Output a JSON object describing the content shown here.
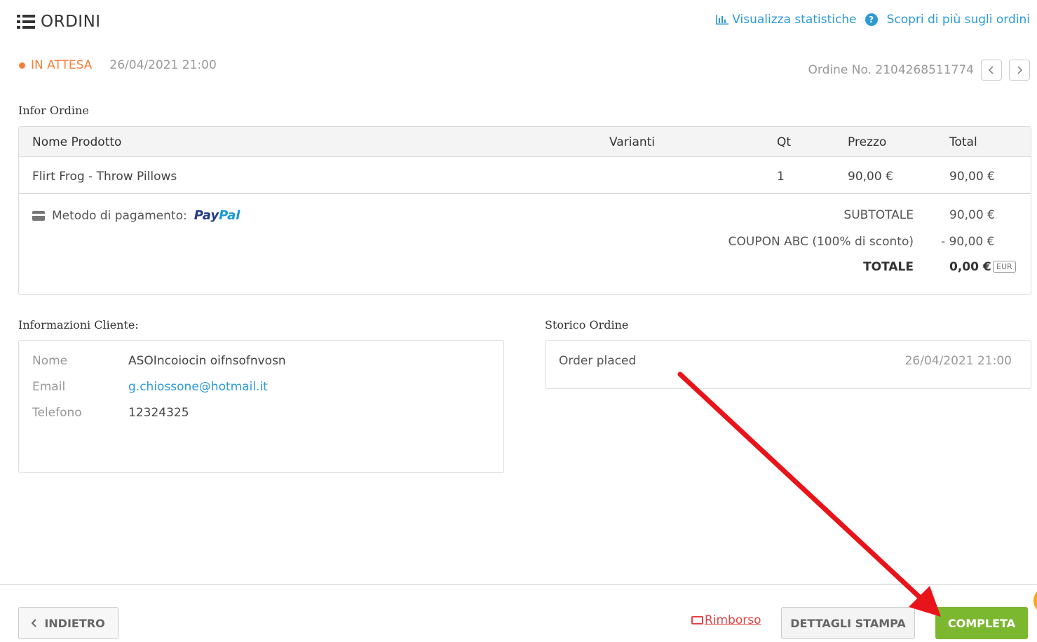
{
  "header": {
    "title": "ORDINI",
    "stats_link": "Visualizza statistiche",
    "help_link": "Scopri di più sugli ordini"
  },
  "status": {
    "state": "IN ATTESA",
    "date": "26/04/2021 21:00",
    "order_number": "Ordine No. 2104268511774"
  },
  "order_info": {
    "section_label": "Infor Ordine",
    "columns": [
      "Nome Prodotto",
      "Varianti",
      "Qt",
      "Prezzo",
      "Total"
    ],
    "rows": [
      {
        "name": "Flirt Frog - Throw Pillows",
        "variant": "",
        "qty": "1",
        "price": "90,00 €",
        "total": "90,00 €"
      }
    ],
    "payment_label": "Metodo di pagamento:",
    "payment_brand_1": "Pay",
    "payment_brand_2": "Pal",
    "subtotal_label": "SUBTOTALE",
    "subtotal_value": "90,00 €",
    "coupon_label": "COUPON ABC (100% di sconto)",
    "coupon_value": "-  90,00 €",
    "total_label": "TOTALE",
    "total_value": "0,00 €",
    "currency": "EUR"
  },
  "customer": {
    "section_label": "Informazioni Cliente:",
    "name_label": "Nome",
    "name_value": "ASOIncoiocin oifnsofnvosn",
    "email_label": "Email",
    "email_value": "g.chiossone@hotmail.it",
    "phone_label": "Telefono",
    "phone_value": "12324325"
  },
  "history": {
    "section_label": "Storico Ordine",
    "event": "Order placed",
    "time": "26/04/2021 21:00"
  },
  "footer": {
    "back_label": "INDIETRO",
    "refund_label": "Rimborso",
    "print_label": "DETTAGLI STAMPA",
    "complete_label": "COMPLETA"
  },
  "colors": {
    "accent_blue": "#2d9ad6",
    "status_orange": "#f5803e",
    "complete_green": "#7cb82f",
    "refund_red": "#e24444",
    "annotation_arrow": "#e8141a"
  }
}
